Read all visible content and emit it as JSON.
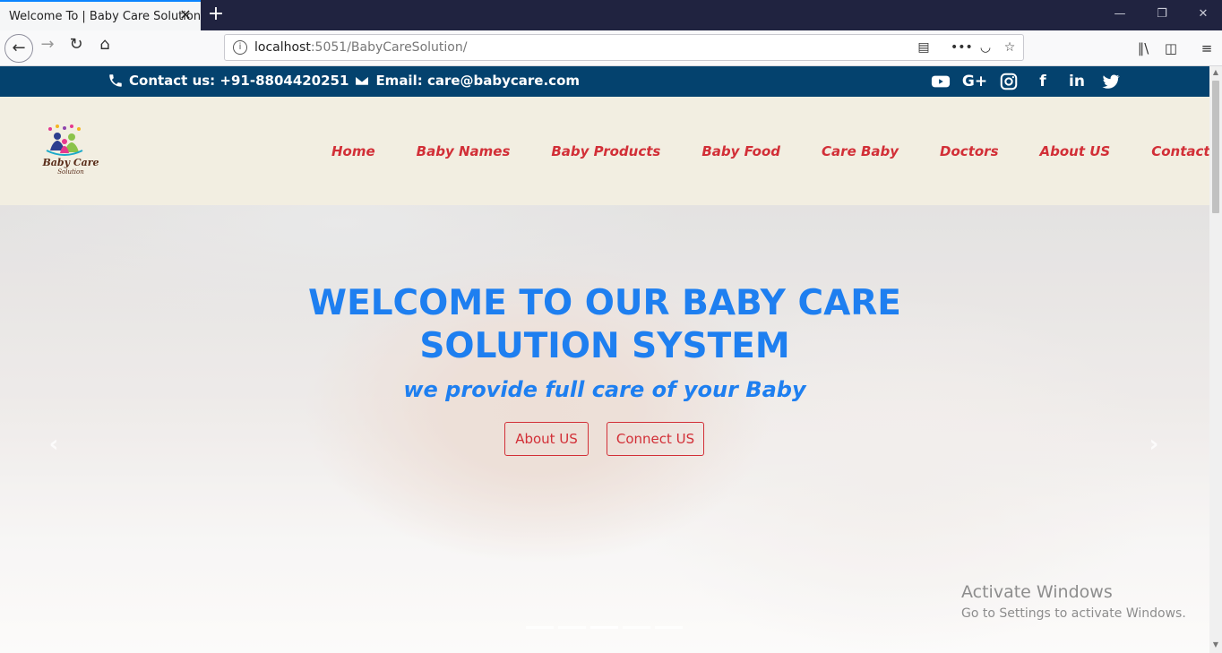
{
  "browser": {
    "tab_title": "Welcome To | Baby Care Solution",
    "url_host": "localhost",
    "url_rest": ":5051/BabyCareSolution/"
  },
  "topbar": {
    "contact_label": "Contact us: +91-8804420251",
    "email_label": "Email: care@babycare.com",
    "socials": [
      "youtube-icon",
      "google-plus-icon",
      "instagram-icon",
      "facebook-icon",
      "linkedin-icon",
      "twitter-icon"
    ]
  },
  "logo": {
    "title": "Baby Care",
    "subtitle": "Solution"
  },
  "menu": {
    "items": [
      "Home",
      "Baby Names",
      "Baby Products",
      "Baby Food",
      "Care Baby",
      "Doctors",
      "About US",
      "Contact US"
    ]
  },
  "hero": {
    "title": "WELCOME TO OUR BABY CARE SOLUTION SYSTEM",
    "subtitle": "we provide full care of your Baby",
    "btn_about": "About US",
    "btn_connect": "Connect US",
    "slide_count": 5,
    "active_slide": 3
  },
  "watermark": {
    "line1": "Activate Windows",
    "line2": "Go to Settings to activate Windows."
  },
  "colors": {
    "topbar_bg": "#04426e",
    "header_bg": "#f2eee1",
    "menu_text": "#d22f37",
    "hero_text": "#1e7ff0"
  }
}
